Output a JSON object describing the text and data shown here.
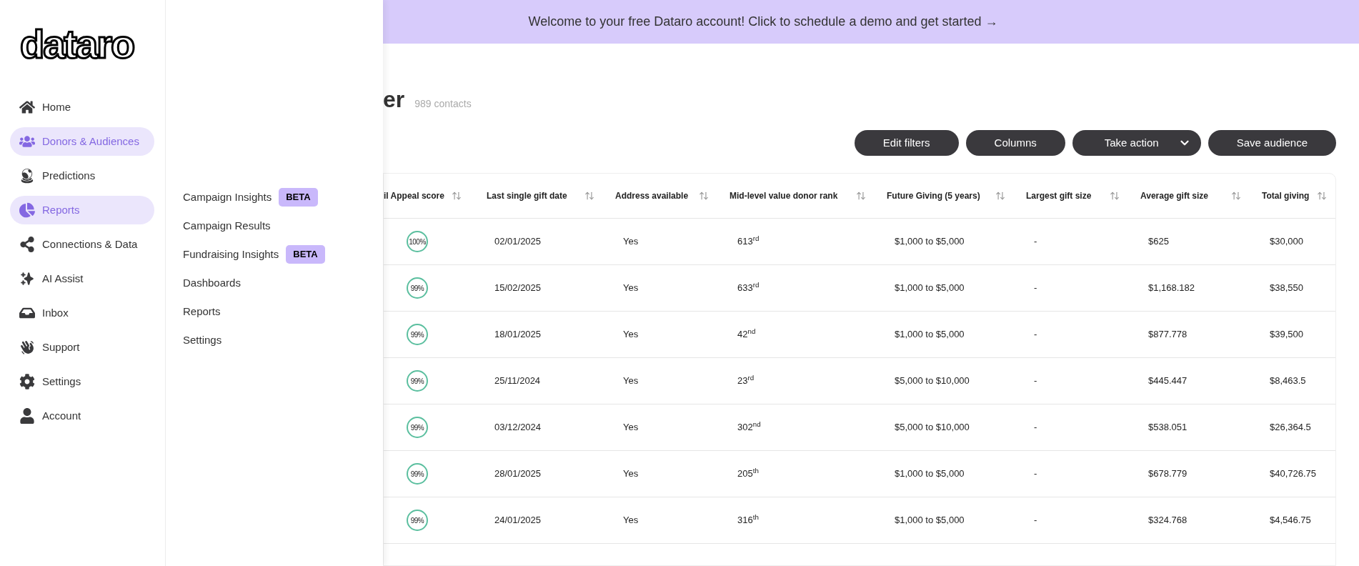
{
  "logo": "dataro",
  "nav": [
    {
      "label": "Home",
      "selected": false
    },
    {
      "label": "Donors & Audiences",
      "selected": true
    },
    {
      "label": "Predictions",
      "selected": false
    },
    {
      "label": "Reports",
      "selected": true
    },
    {
      "label": "Connections & Data",
      "selected": false
    },
    {
      "label": "AI Assist",
      "selected": false
    },
    {
      "label": "Inbox",
      "selected": false
    },
    {
      "label": "Support",
      "selected": false
    },
    {
      "label": "Settings",
      "selected": false
    },
    {
      "label": "Account",
      "selected": false
    }
  ],
  "submenu": [
    {
      "label": "Campaign Insights",
      "badge": "BETA"
    },
    {
      "label": "Campaign Results"
    },
    {
      "label": "Fundraising Insights",
      "badge": "BETA"
    },
    {
      "label": "Dashboards"
    },
    {
      "label": "Reports"
    },
    {
      "label": "Settings"
    }
  ],
  "banner": "Welcome to your free Dataro account! Click to schedule a demo and get started →",
  "title": "er",
  "count": "989 contacts",
  "buttons": [
    {
      "label": "Edit filters",
      "kind": "plain"
    },
    {
      "label": "Columns",
      "kind": "plain"
    },
    {
      "label": "Take action",
      "kind": "dropdown"
    },
    {
      "label": "Save audience",
      "kind": "plain"
    }
  ],
  "table": {
    "columns": [
      "il Appeal score",
      "Last single gift date",
      "Address available",
      "Mid-level value donor rank",
      "Future Giving (5 years)",
      "Largest gift size",
      "Average gift size",
      "Total giving"
    ],
    "rows": [
      [
        "100%",
        "02/01/2025",
        "Yes",
        "613$^{rd}$",
        "$1,000 to $5,000",
        "-",
        "$625",
        "$30,000"
      ],
      [
        "99%",
        "15/02/2025",
        "Yes",
        "633$^{rd}$",
        "$1,000 to $5,000",
        "-",
        "$1,168.182",
        "$38,550"
      ],
      [
        "99%",
        "18/01/2025",
        "Yes",
        "42$^{nd}$",
        "$1,000 to $5,000",
        "-",
        "$877.778",
        "$39,500"
      ],
      [
        "99%",
        "25/11/2024",
        "Yes",
        "23$^{rd}$",
        "$5,000 to $10,000",
        "-",
        "$445.447",
        "$8,463.5"
      ],
      [
        "99%",
        "03/12/2024",
        "Yes",
        "302$^{nd}$",
        "$5,000 to $10,000",
        "-",
        "$538.051",
        "$26,364.5"
      ],
      [
        "99%",
        "28/01/2025",
        "Yes",
        "205$^{th}$",
        "$1,000 to $5,000",
        "-",
        "$678.779",
        "$40,726.75"
      ],
      [
        "99%",
        "24/01/2025",
        "Yes",
        "316$^{th}$",
        "$1,000 to $5,000",
        "-",
        "$324.768",
        "$4,546.75"
      ]
    ]
  }
}
